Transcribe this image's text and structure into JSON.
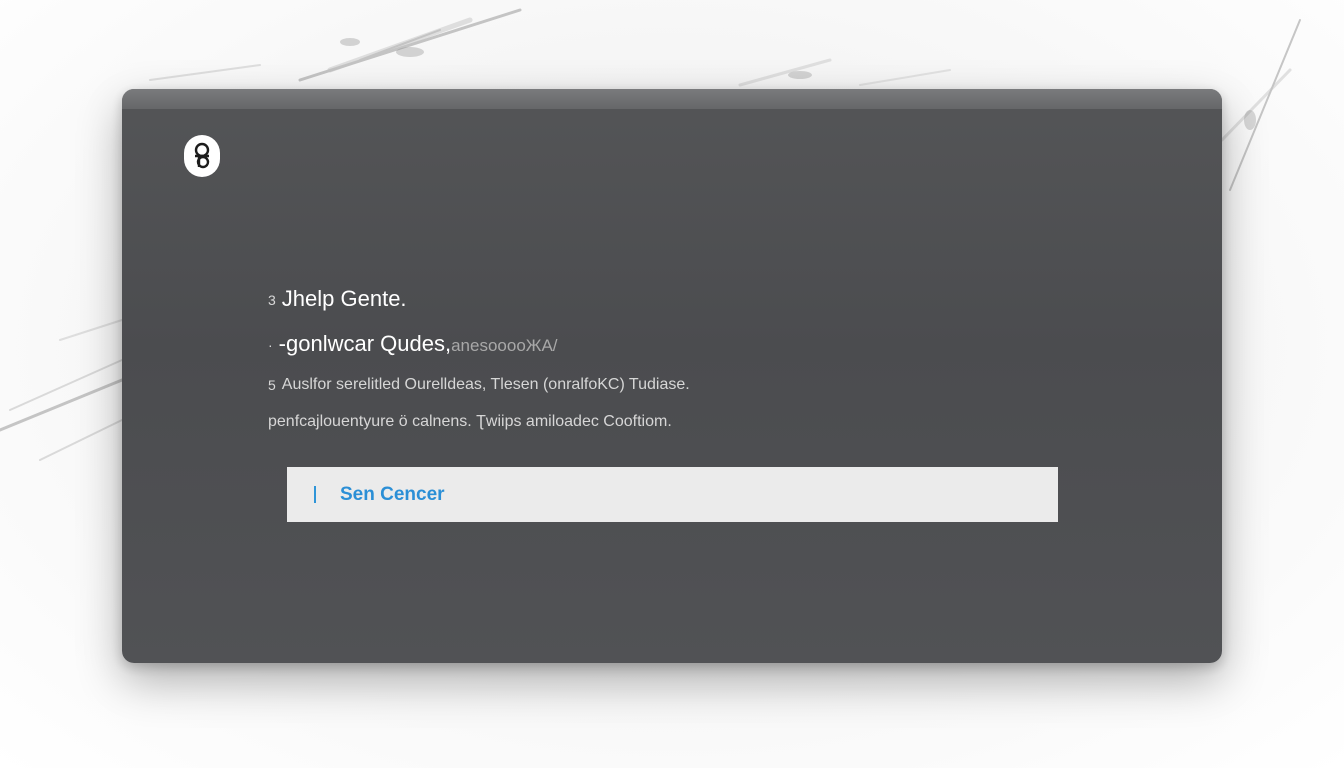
{
  "dialog": {
    "logo_icon": "help-question-icon",
    "help_title": "Jhelp Gente.",
    "help_title_marker": "3",
    "subtitle_main": "-gonlwcar Qudes,",
    "subtitle_faded": "anesooooЖA/",
    "subtitle_marker": "·",
    "description_marker": "5",
    "description_line1": "Auslfor serelitled Ourelldeas, Tlesen (onralfoKC)  Tudiase.",
    "description_line2": "penfcajlouentyure ö calnens.  Ʈwiips  amiloadec  Cooftiom.",
    "send_button_label": "Sen Cencer"
  },
  "colors": {
    "window_bg": "#4e4f52",
    "window_topbar": "#707173",
    "text_primary": "#ffffff",
    "text_secondary": "#d6d6d6",
    "button_bg": "#ebebeb",
    "button_text": "#2b8fd6"
  }
}
